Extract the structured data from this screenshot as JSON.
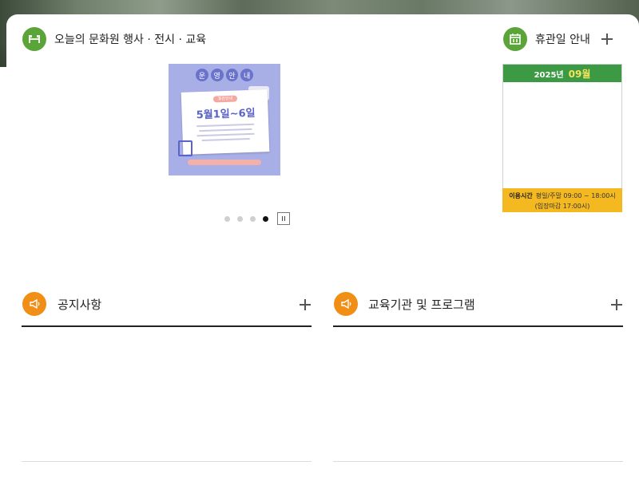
{
  "events": {
    "title": "오늘의 문화원 행사 · 전시 · 교육",
    "icon": "building-icon",
    "poster": {
      "header": [
        "운",
        "영",
        "안",
        "내"
      ],
      "tag": "휴관안내",
      "headline": "5월1일~6일"
    },
    "slider": {
      "dot_count": 4,
      "active_index": 3,
      "pause_label": "II"
    }
  },
  "holiday": {
    "title": "휴관일 안내",
    "icon": "calendar-icon",
    "calendar": {
      "year": "2025년",
      "month": "09월",
      "hours_label": "이용시간",
      "hours_text": "평일/주말 09:00 ~ 18:00시",
      "last_entry": "(입장마감 17:00시)"
    }
  },
  "notice": {
    "title": "공지사항",
    "icon": "megaphone-icon"
  },
  "education": {
    "title": "교육기관 및 프로그램",
    "icon": "megaphone-icon"
  },
  "colors": {
    "green": "#5aa43a",
    "orange": "#f18e16",
    "calendar_green": "#3d9a44",
    "calendar_yellow": "#f4b820"
  }
}
